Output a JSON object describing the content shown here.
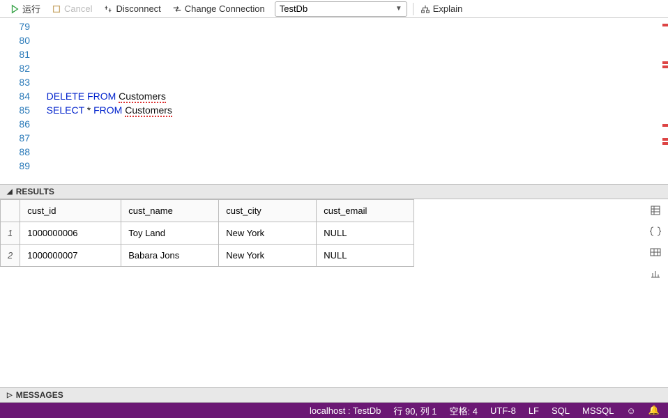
{
  "toolbar": {
    "run": "运行",
    "cancel": "Cancel",
    "disconnect": "Disconnect",
    "changeConn": "Change Connection",
    "db": "TestDb",
    "explain": "Explain"
  },
  "editor": {
    "lines": [
      "79",
      "80",
      "81",
      "82",
      "83",
      "84",
      "85",
      "86",
      "87",
      "88",
      "89"
    ],
    "code84_pre": "   ",
    "code84_kw1": "DELETE",
    "code84_kw2": "FROM",
    "code84_tbl": "Customers",
    "code85_pre": "   ",
    "code85_kw1": "SELECT",
    "code85_star": " * ",
    "code85_kw2": "FROM",
    "code85_tbl": "Customers"
  },
  "panels": {
    "results": "RESULTS",
    "messages": "MESSAGES"
  },
  "grid": {
    "cols": [
      "cust_id",
      "cust_name",
      "cust_city",
      "cust_email"
    ],
    "rows": [
      {
        "n": "1",
        "cust_id": "1000000006",
        "cust_name": "Toy Land",
        "cust_city": "New York",
        "cust_email": "NULL"
      },
      {
        "n": "2",
        "cust_id": "1000000007",
        "cust_name": "Babara Jons",
        "cust_city": "New York",
        "cust_email": "NULL"
      }
    ]
  },
  "status": {
    "conn": "localhost : TestDb",
    "pos": "行 90,  列 1",
    "spaces": "空格: 4",
    "enc": "UTF-8",
    "eol": "LF",
    "lang": "SQL",
    "srv": "MSSQL"
  }
}
